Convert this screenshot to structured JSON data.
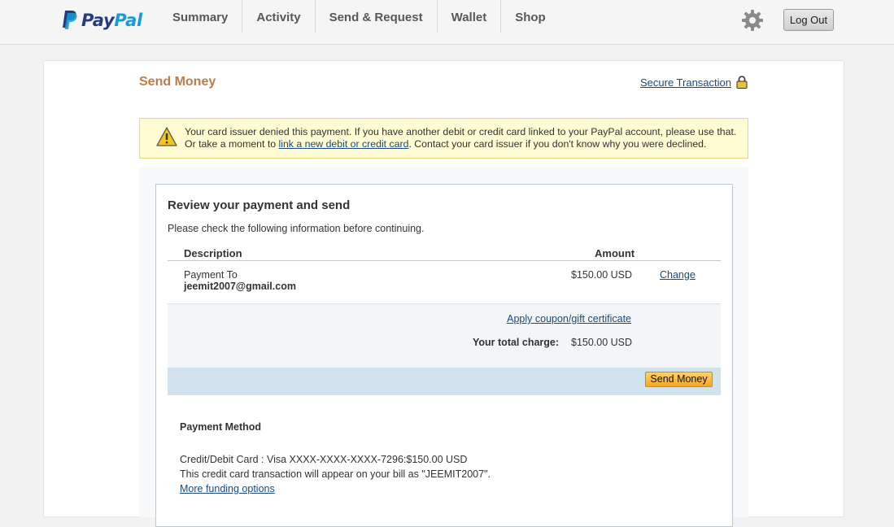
{
  "brand": {
    "pay": "Pay",
    "pal": "Pal"
  },
  "nav": {
    "items": [
      "Summary",
      "Activity",
      "Send & Request",
      "Wallet",
      "Shop"
    ],
    "logout": "Log Out"
  },
  "page": {
    "title": "Send Money",
    "secure_link": "Secure Transaction"
  },
  "alert": {
    "text_1": "Your card issuer denied this payment. If you have another debit or credit card linked to your PayPal account, please use that. Or take a moment to ",
    "link": "link a new debit or credit card",
    "text_2": ". Contact your card issuer if you don't know why you were declined."
  },
  "review": {
    "title": "Review your payment and send",
    "subtitle": "Please check the following information before continuing.",
    "col_description": "Description",
    "col_amount": "Amount",
    "payment_to_label": "Payment To",
    "payment_to_email": "jeemit2007@gmail.com",
    "payment_amount": "$150.00 USD",
    "change_link": "Change",
    "coupon_link": "Apply coupon/gift certificate",
    "total_label": "Your total charge:",
    "total_amount": "$150.00 USD",
    "send_button": "Send Money"
  },
  "payment_method": {
    "title": "Payment Method",
    "card_line": "Credit/Debit Card : Visa XXXX-XXXX-XXXX-7296:$150.00 USD",
    "bill_line": "This credit card transaction will appear on your bill as \"JEEMIT2007\".",
    "more_link": "More funding options"
  },
  "colors": {
    "brand_dark": "#253b80",
    "brand_light": "#179bd7",
    "title": "#b3804b",
    "link": "#1a4a7a",
    "alert_bg": "#fffbd2",
    "send_button": "#f6a623"
  }
}
